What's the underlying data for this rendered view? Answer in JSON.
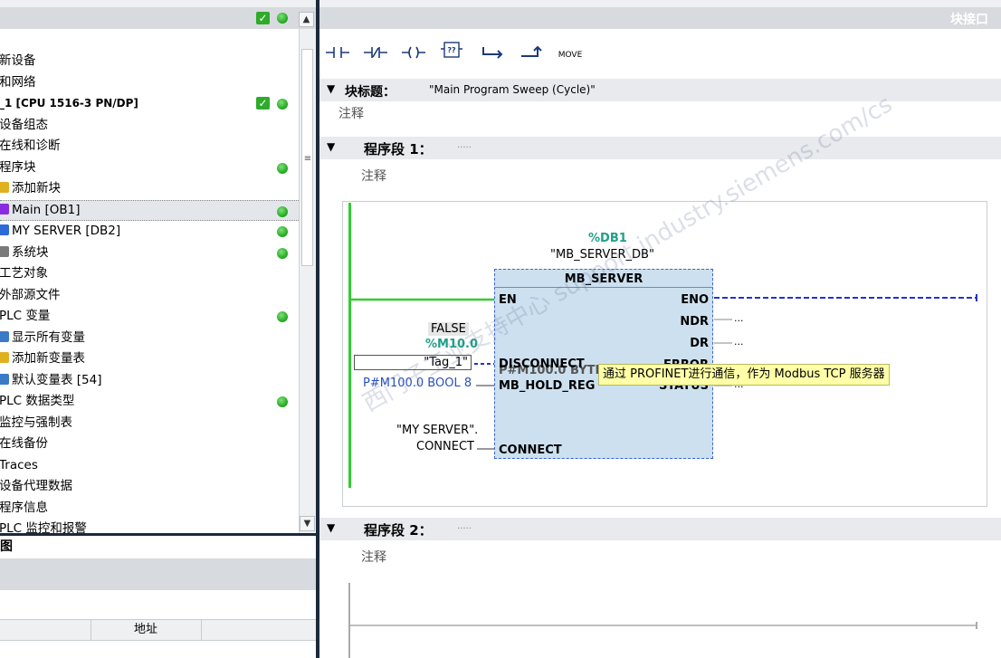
{
  "project_tree": {
    "items": [
      {
        "label": "新设备",
        "bold": false,
        "status": ""
      },
      {
        "label": "和网络",
        "bold": false,
        "status": ""
      },
      {
        "label": "_1 [CPU 1516-3 PN/DP]",
        "bold": true,
        "status": "check-ok"
      },
      {
        "label": "设备组态",
        "bold": false,
        "status": ""
      },
      {
        "label": "在线和诊断",
        "bold": false,
        "status": ""
      },
      {
        "label": "程序块",
        "bold": false,
        "status": "ok"
      },
      {
        "label": "添加新块",
        "bold": false,
        "status": "",
        "icon": "add-block-icon"
      },
      {
        "label": "Main [OB1]",
        "bold": false,
        "status": "ok",
        "icon": "ob-block-icon",
        "selected": true
      },
      {
        "label": "MY SERVER [DB2]",
        "bold": false,
        "status": "ok",
        "icon": "db-block-icon"
      },
      {
        "label": "系统块",
        "bold": false,
        "status": "ok",
        "icon": "system-block-icon"
      },
      {
        "label": "工艺对象",
        "bold": false,
        "status": ""
      },
      {
        "label": "外部源文件",
        "bold": false,
        "status": ""
      },
      {
        "label": "PLC 变量",
        "bold": false,
        "status": "ok"
      },
      {
        "label": "显示所有变量",
        "bold": false,
        "status": "",
        "icon": "tag-table-icon"
      },
      {
        "label": "添加新变量表",
        "bold": false,
        "status": "",
        "icon": "add-tag-table-icon"
      },
      {
        "label": "默认变量表 [54]",
        "bold": false,
        "status": "",
        "icon": "default-tag-table-icon"
      },
      {
        "label": "PLC 数据类型",
        "bold": false,
        "status": "ok"
      },
      {
        "label": "监控与强制表",
        "bold": false,
        "status": ""
      },
      {
        "label": "在线备份",
        "bold": false,
        "status": ""
      },
      {
        "label": "Traces",
        "bold": false,
        "status": ""
      },
      {
        "label": "设备代理数据",
        "bold": false,
        "status": ""
      },
      {
        "label": "程序信息",
        "bold": false,
        "status": ""
      },
      {
        "label": "PLC 监控和报警",
        "bold": false,
        "status": ""
      }
    ]
  },
  "bottom_panel": {
    "title": "图",
    "column_address": "地址"
  },
  "editor": {
    "window_title": "块接口",
    "toolbar": {
      "move_label": "MOVE"
    },
    "block_title_label": "块标题：",
    "block_title_value": "\"Main Program Sweep (Cycle)\"",
    "block_comment": "注释",
    "network1": {
      "label": "程序段 1：",
      "ellipsis": ".....",
      "comment": "注释",
      "instance_db_address": "%DB1",
      "instance_db_name": "\"MB_SERVER_DB\"",
      "fb_name": "MB_SERVER",
      "pin_en": "EN",
      "pin_eno": "ENO",
      "pin_ndr": "NDR",
      "pin_dr": "DR",
      "pin_error": "ERROR",
      "pin_status": "STATUS",
      "pin_disconnect": "DISCONNECT",
      "pin_mb_hold_reg": "MB_HOLD_REG",
      "pin_connect": "CONNECT",
      "pin_overlay": "P#M100.0 BYTE",
      "out_placeholder": "...",
      "disconnect_value": "FALSE",
      "disconnect_address": "%M10.0",
      "disconnect_tag": "\"Tag_1\"",
      "hold_reg_value": "P#M100.0 BOOL 8",
      "connect_tag_line1": "\"MY SERVER\".",
      "connect_tag_line2": "CONNECT",
      "tooltip": "通过 PROFINET进行通信，作为 Modbus TCP 服务器"
    },
    "network2": {
      "label": "程序段 2：",
      "ellipsis": ".....",
      "comment": "注释"
    },
    "watermark": "西门子工业支持中心 support.industry.siemens.com/cs"
  },
  "colors": {
    "status_green": "#1ea51a",
    "power_rail": "#33cc33",
    "eno_wire": "#2233cc",
    "fb_fill": "#cde0ef",
    "panel_gray": "#d7dade",
    "splitter": "#1b2a3a",
    "address_green": "#1fa08a",
    "address_blue": "#2a4fbf"
  }
}
